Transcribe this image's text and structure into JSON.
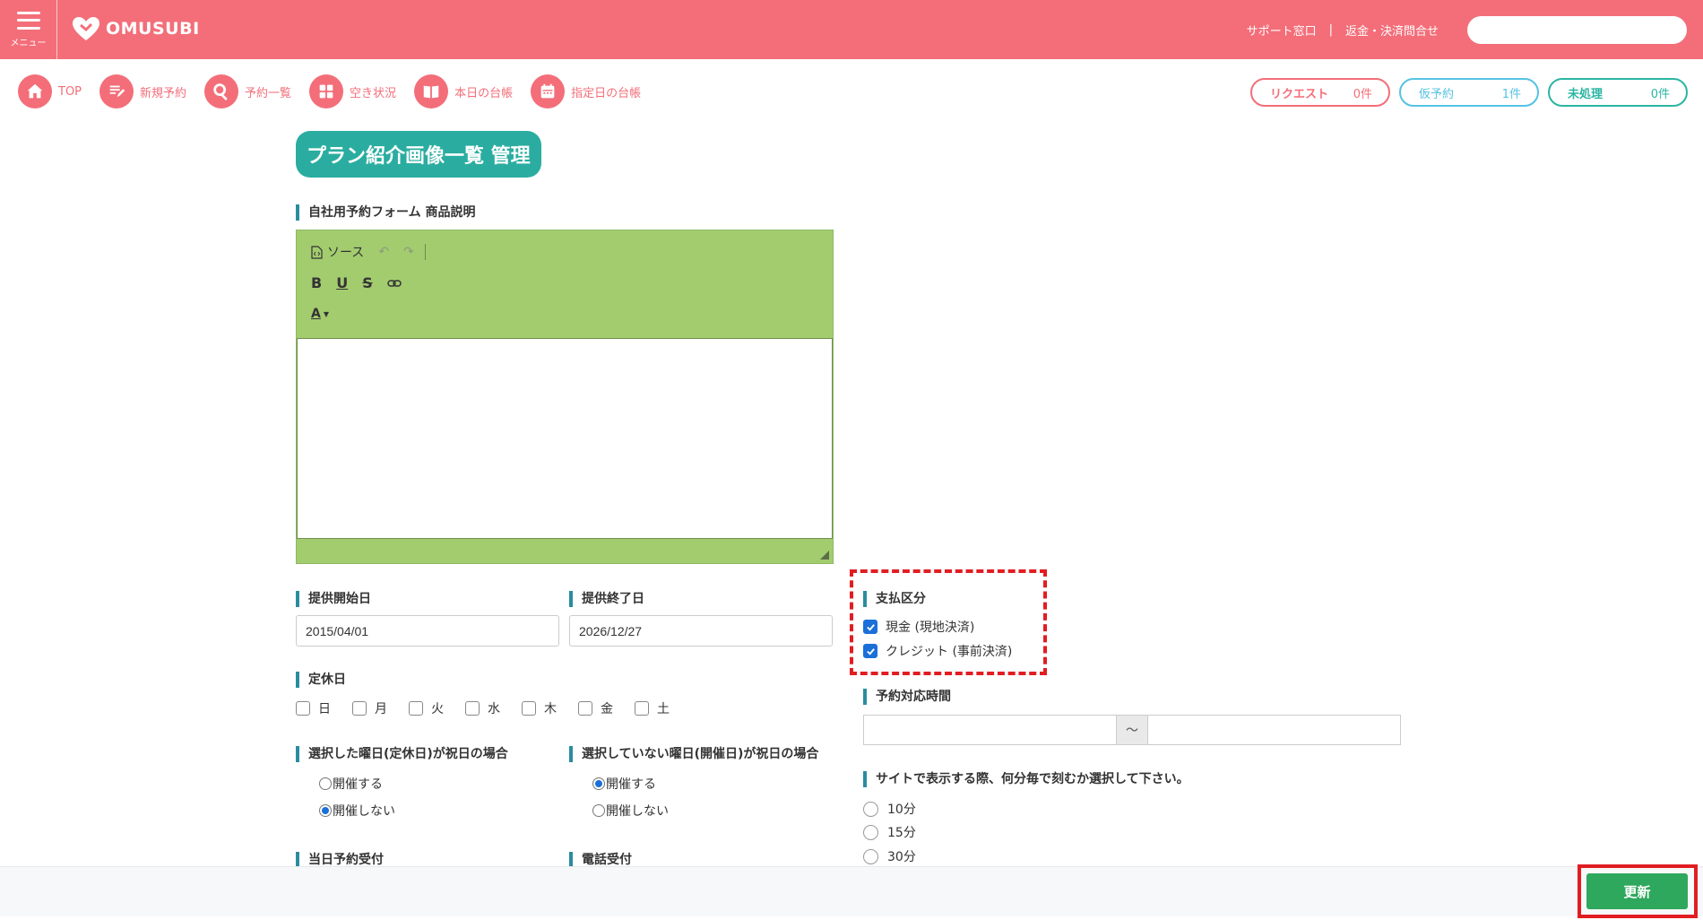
{
  "header": {
    "menu_label": "メニュー",
    "brand": "OMUSUBI",
    "support_link": "サポート窓口",
    "separator": "|",
    "refund_link": "返金・決済問合せ",
    "search_value": ""
  },
  "nav": {
    "items": [
      {
        "label": "TOP",
        "icon": "home-icon"
      },
      {
        "label": "新規予約",
        "icon": "edit-icon"
      },
      {
        "label": "予約一覧",
        "icon": "search-icon"
      },
      {
        "label": "空き状況",
        "icon": "grid-icon"
      },
      {
        "label": "本日の台帳",
        "icon": "book-icon"
      },
      {
        "label": "指定日の台帳",
        "icon": "calendar-icon"
      }
    ],
    "badges": {
      "request": {
        "label": "リクエスト",
        "count": "0件"
      },
      "tentative": {
        "label": "仮予約",
        "count": "1件"
      },
      "unprocessed": {
        "label": "未処理",
        "count": "0件"
      }
    }
  },
  "page": {
    "title": "プラン紹介画像一覧 管理"
  },
  "description": {
    "label": "自社用予約フォーム 商品説明",
    "toolbar": {
      "source": "ソース",
      "undo": "↶",
      "redo": "↷",
      "bold": "B",
      "underline": "U",
      "strike": "S",
      "link": "⚭",
      "font_color": "A"
    }
  },
  "period": {
    "start_label": "提供開始日",
    "start_value": "2015/04/01",
    "end_label": "提供終了日",
    "end_value": "2026/12/27"
  },
  "holidays": {
    "label": "定休日",
    "days": [
      "日",
      "月",
      "火",
      "水",
      "木",
      "金",
      "土"
    ]
  },
  "holiday_selected": {
    "label": "選択した曜日(定休日)が祝日の場合",
    "options": [
      {
        "label": "開催する",
        "checked": false
      },
      {
        "label": "開催しない",
        "checked": true
      }
    ]
  },
  "holiday_unselected": {
    "label": "選択していない曜日(開催日)が祝日の場合",
    "options": [
      {
        "label": "開催する",
        "checked": true
      },
      {
        "label": "開催しない",
        "checked": false
      }
    ]
  },
  "same_day": {
    "label": "当日予約受付"
  },
  "phone": {
    "label": "電話受付"
  },
  "payment": {
    "label": "支払区分",
    "options": [
      {
        "label": "現金 (現地決済)",
        "checked": true
      },
      {
        "label": "クレジット (事前決済)",
        "checked": true
      }
    ]
  },
  "hours": {
    "label": "予約対応時間",
    "tilde": "〜"
  },
  "interval": {
    "label": "サイトで表示する際、何分毎で刻むか選択して下さい。",
    "options": [
      "10分",
      "15分",
      "30分"
    ]
  },
  "footer": {
    "update_label": "更新"
  },
  "colors": {
    "brand": "#f36e79",
    "title": "#2aada0",
    "editor": "#a3cc6f",
    "update": "#2ea85c",
    "highlight": "#e11d22"
  }
}
